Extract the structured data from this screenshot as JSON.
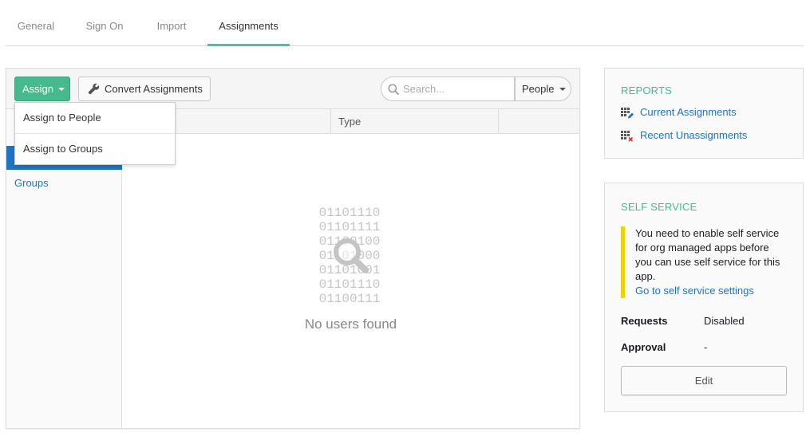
{
  "tabs": [
    {
      "label": "General"
    },
    {
      "label": "Sign On"
    },
    {
      "label": "Import"
    },
    {
      "label": "Assignments",
      "active": true
    }
  ],
  "toolbar": {
    "assign_label": "Assign",
    "convert_label": "Convert Assignments",
    "search_placeholder": "Search...",
    "filter_selected": "People"
  },
  "assign_menu": {
    "items": [
      {
        "label": "Assign to People"
      },
      {
        "label": "Assign to Groups"
      }
    ]
  },
  "sidebar": {
    "items": [
      {
        "label": "",
        "active": true
      },
      {
        "label": "Groups"
      }
    ]
  },
  "table": {
    "columns": [
      "",
      "Type",
      ""
    ]
  },
  "empty_state": {
    "binary": [
      "01101110",
      "01101111",
      "01100100",
      "01101000",
      "01101001",
      "01101110",
      "01100111"
    ],
    "message": "No users found"
  },
  "reports": {
    "title": "REPORTS",
    "links": [
      {
        "label": "Current Assignments",
        "icon": "grid-pencil-icon"
      },
      {
        "label": "Recent Unassignments",
        "icon": "grid-x-icon"
      }
    ]
  },
  "self_service": {
    "title": "SELF SERVICE",
    "notice_text": "You need to enable self service for org managed apps before you can use self service for this app.",
    "notice_link": "Go to self service settings",
    "rows": [
      {
        "label": "Requests",
        "value": "Disabled"
      },
      {
        "label": "Approval",
        "value": "-"
      }
    ],
    "edit_label": "Edit"
  },
  "colors": {
    "accent_green": "#46b98e",
    "link_blue": "#1e74c0",
    "notice_yellow": "#f1d10b"
  }
}
